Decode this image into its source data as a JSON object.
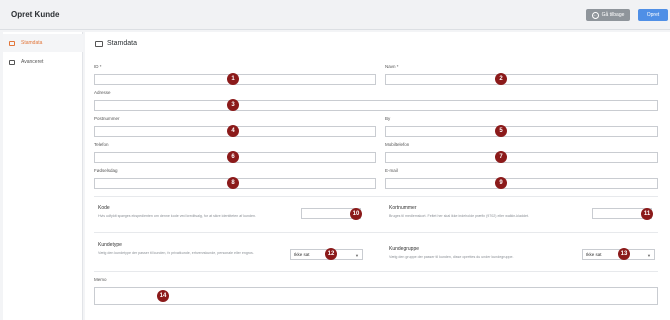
{
  "header": {
    "title": "Opret Kunde",
    "back_label": "Gå tilbage",
    "create_label": "Opret"
  },
  "sidebar": {
    "items": [
      {
        "label": "Stamdata"
      },
      {
        "label": "Avanceret"
      }
    ]
  },
  "section": {
    "title": "Stamdata"
  },
  "fields": {
    "id": {
      "label": "ID *",
      "value": ""
    },
    "navn": {
      "label": "Navn *",
      "value": ""
    },
    "adresse": {
      "label": "Adresse",
      "value": ""
    },
    "postnummer": {
      "label": "Postnummer",
      "value": ""
    },
    "by": {
      "label": "By",
      "value": ""
    },
    "telefon": {
      "label": "Telefon",
      "value": ""
    },
    "mobiltelefon": {
      "label": "Mobiltelefon",
      "value": ""
    },
    "foedselsdag": {
      "label": "Fødselsdag",
      "value": ""
    },
    "email": {
      "label": "E-mail",
      "value": ""
    },
    "kode": {
      "label": "Kode",
      "help": "Hvis udfyldt spørges ekspedienten om denne kode ved kreditsalg, for at sikre identiteten af kunden.",
      "value": ""
    },
    "kortnummer": {
      "label": "Kortnummer",
      "help": "Bruges til medlemskort. Feltet her skal ikke indeholde præfix (9702) eller walkin-kladdet.",
      "value": ""
    },
    "kundetype": {
      "label": "Kundetype",
      "help": "Vælg den kundetype der passer til kunden, fx privatkunde, erhvervskunde, personale eller engros.",
      "selected": "Ikke sat"
    },
    "kundegruppe": {
      "label": "Kundegruppe",
      "help": "Vælg den gruppe der passer til kunden, disse oprettes du under kundegruppe.",
      "selected": "Ikke sat"
    },
    "memo": {
      "label": "Memo",
      "value": ""
    }
  },
  "badges": [
    "1",
    "2",
    "3",
    "4",
    "5",
    "6",
    "7",
    "8",
    "9",
    "10",
    "11",
    "12",
    "13",
    "14"
  ],
  "colors": {
    "accent": "#e2763a",
    "primary": "#4f8fe6",
    "badge": "#8b1a1a"
  }
}
